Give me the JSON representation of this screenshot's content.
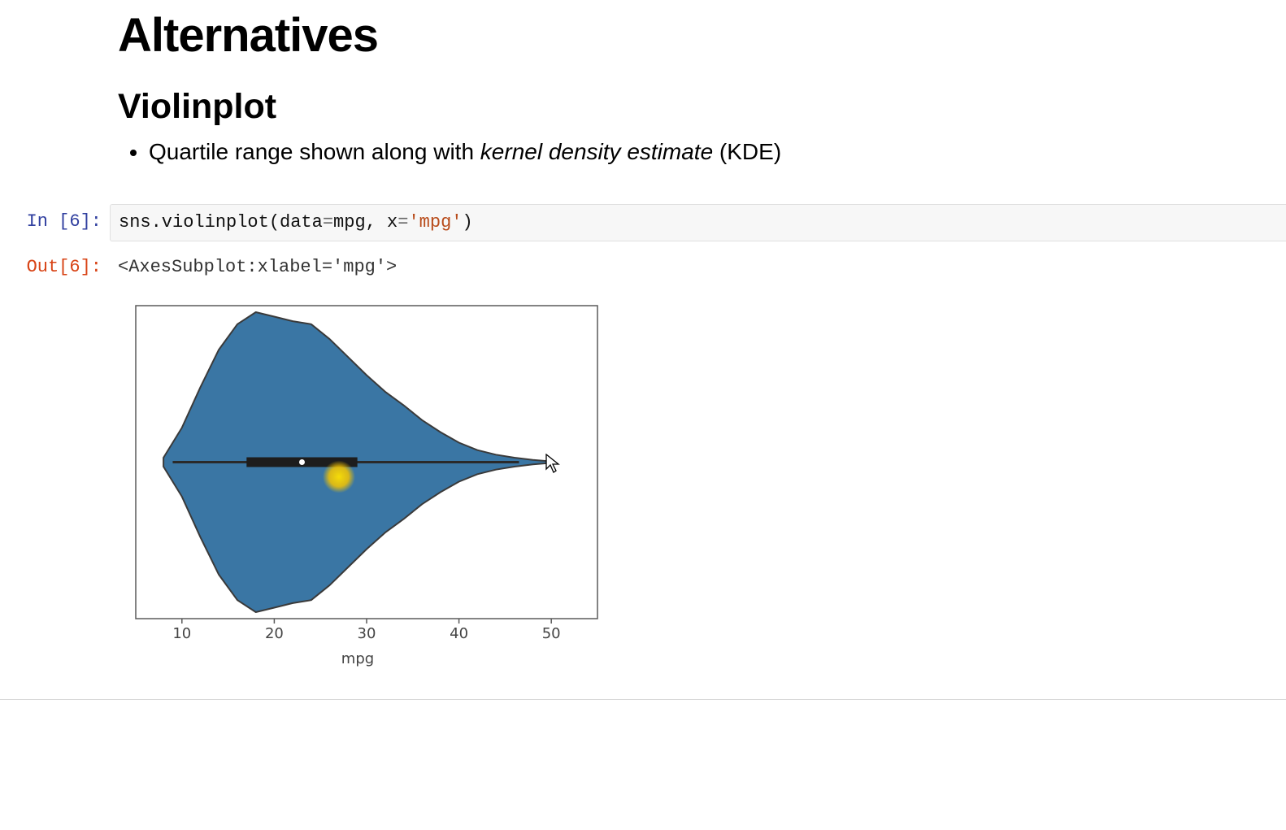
{
  "headings": {
    "title": "Alternatives",
    "subtitle": "Violinplot"
  },
  "bullet": {
    "pre": "Quartile range shown along with ",
    "italic": "kernel density estimate",
    "post": " (KDE)"
  },
  "cell": {
    "in_prompt": "In [6]:",
    "out_prompt": "Out[6]:",
    "code_parts": {
      "p1": "sns.violinplot(data",
      "eq1": "=",
      "p2": "mpg, x",
      "eq2": "=",
      "str": "'mpg'",
      "end": ")"
    },
    "output_text": "<AxesSubplot:xlabel='mpg'>"
  },
  "chart_data": {
    "type": "violin",
    "xlabel": "mpg",
    "xlim": [
      5,
      55
    ],
    "xticks": [
      10,
      20,
      30,
      40,
      50
    ],
    "median": 23,
    "q1": 17,
    "q3": 29,
    "whisker_min": 9,
    "whisker_max": 46.5,
    "kde": [
      {
        "x": 8,
        "d": 0.03
      },
      {
        "x": 10,
        "d": 0.23
      },
      {
        "x": 12,
        "d": 0.5
      },
      {
        "x": 14,
        "d": 0.75
      },
      {
        "x": 16,
        "d": 0.92
      },
      {
        "x": 18,
        "d": 1.0
      },
      {
        "x": 20,
        "d": 0.97
      },
      {
        "x": 22,
        "d": 0.94
      },
      {
        "x": 24,
        "d": 0.92
      },
      {
        "x": 26,
        "d": 0.82
      },
      {
        "x": 28,
        "d": 0.7
      },
      {
        "x": 30,
        "d": 0.58
      },
      {
        "x": 32,
        "d": 0.47
      },
      {
        "x": 34,
        "d": 0.38
      },
      {
        "x": 36,
        "d": 0.28
      },
      {
        "x": 38,
        "d": 0.2
      },
      {
        "x": 40,
        "d": 0.13
      },
      {
        "x": 42,
        "d": 0.08
      },
      {
        "x": 44,
        "d": 0.05
      },
      {
        "x": 46,
        "d": 0.03
      },
      {
        "x": 48,
        "d": 0.015
      },
      {
        "x": 50,
        "d": 0.005
      }
    ],
    "fill_color": "#3a76a4",
    "stroke_color": "#3a3a3a"
  },
  "highlight_dot_x": 27,
  "cursor_at_x": 49
}
